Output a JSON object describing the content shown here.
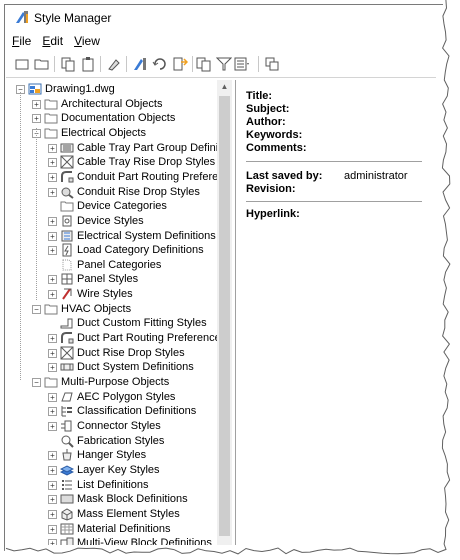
{
  "window": {
    "title": "Style Manager"
  },
  "menu": [
    {
      "label": "File",
      "key": "F",
      "rest": "ile"
    },
    {
      "label": "Edit",
      "key": "E",
      "rest": "dit"
    },
    {
      "label": "View",
      "key": "V",
      "rest": "iew"
    }
  ],
  "toolbar": [
    "new-icon",
    "open-icon",
    "copy-icon",
    "paste-icon",
    "purge-icon",
    "edit-style-icon",
    "refresh-icon",
    "import-icon",
    "filter-style-icon",
    "filter-icon",
    "view-options-icon",
    "toggle-view-icon"
  ],
  "tree": {
    "root": "Drawing1.dwg",
    "categories": [
      {
        "label": "Architectural Objects",
        "expanded": false,
        "items": []
      },
      {
        "label": "Documentation Objects",
        "expanded": false,
        "items": []
      },
      {
        "label": "Electrical Objects",
        "expanded": true,
        "items": [
          {
            "label": "Cable Tray Part Group Definitions",
            "icon": "cable-tray-group-icon",
            "expandable": true
          },
          {
            "label": "Cable Tray Rise Drop Styles",
            "icon": "rise-drop-icon",
            "expandable": true
          },
          {
            "label": "Conduit Part Routing Preferences",
            "icon": "routing-icon",
            "expandable": true
          },
          {
            "label": "Conduit Rise Drop Styles",
            "icon": "conduit-rise-icon",
            "expandable": true
          },
          {
            "label": "Device Categories",
            "icon": "folder-icon",
            "expandable": false
          },
          {
            "label": "Device Styles",
            "icon": "device-icon",
            "expandable": true
          },
          {
            "label": "Electrical System Definitions",
            "icon": "electrical-system-icon",
            "expandable": true
          },
          {
            "label": "Load Category Definitions",
            "icon": "load-category-icon",
            "expandable": true
          },
          {
            "label": "Panel Categories",
            "icon": "panel-category-icon",
            "expandable": false
          },
          {
            "label": "Panel Styles",
            "icon": "panel-icon",
            "expandable": true
          },
          {
            "label": "Wire Styles",
            "icon": "wire-icon",
            "expandable": true
          }
        ]
      },
      {
        "label": "HVAC Objects",
        "expanded": true,
        "items": [
          {
            "label": "Duct Custom Fitting Styles",
            "icon": "duct-fitting-icon",
            "expandable": false
          },
          {
            "label": "Duct Part Routing Preferences",
            "icon": "routing-icon",
            "expandable": true
          },
          {
            "label": "Duct Rise Drop Styles",
            "icon": "rise-drop-icon",
            "expandable": true
          },
          {
            "label": "Duct System Definitions",
            "icon": "duct-system-icon",
            "expandable": true
          }
        ]
      },
      {
        "label": "Multi-Purpose Objects",
        "expanded": true,
        "items": [
          {
            "label": "AEC Polygon Styles",
            "icon": "polygon-icon",
            "expandable": true
          },
          {
            "label": "Classification Definitions",
            "icon": "classification-icon",
            "expandable": true
          },
          {
            "label": "Connector Styles",
            "icon": "connector-icon",
            "expandable": true
          },
          {
            "label": "Fabrication Styles",
            "icon": "fabrication-icon",
            "expandable": false
          },
          {
            "label": "Hanger Styles",
            "icon": "hanger-icon",
            "expandable": true
          },
          {
            "label": "Layer Key Styles",
            "icon": "layer-key-icon",
            "expandable": true
          },
          {
            "label": "List Definitions",
            "icon": "list-icon",
            "expandable": true
          },
          {
            "label": "Mask Block Definitions",
            "icon": "mask-block-icon",
            "expandable": true
          },
          {
            "label": "Mass Element Styles",
            "icon": "mass-element-icon",
            "expandable": true
          },
          {
            "label": "Material Definitions",
            "icon": "material-icon",
            "expandable": true
          },
          {
            "label": "Multi-View Block Definitions",
            "icon": "multiview-icon",
            "expandable": true
          }
        ]
      }
    ]
  },
  "properties": {
    "title_label": "Title:",
    "subject_label": "Subject:",
    "author_label": "Author:",
    "keywords_label": "Keywords:",
    "comments_label": "Comments:",
    "last_saved_label": "Last saved by:",
    "last_saved_value": "administrator",
    "revision_label": "Revision:",
    "hyperlink_label": "Hyperlink:"
  },
  "colors": {
    "accent": "#1e6fd0",
    "border": "#a0a0a0",
    "scrollbar_thumb": "#cdcdcd"
  }
}
